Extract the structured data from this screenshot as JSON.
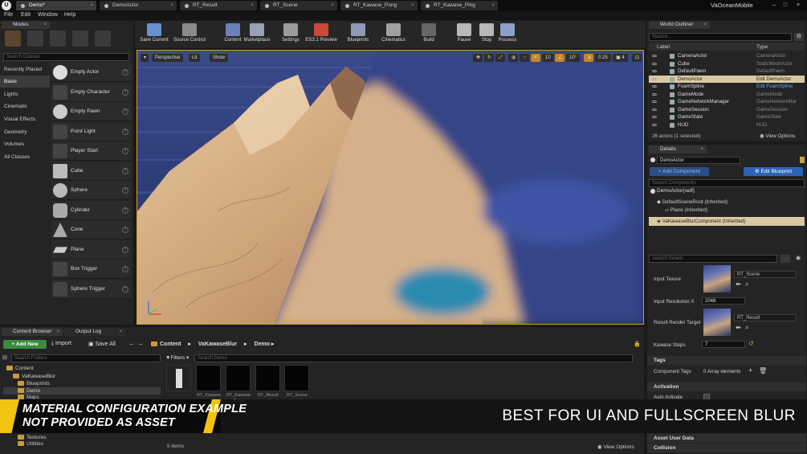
{
  "window": {
    "tabs": [
      {
        "label": "Demo*"
      },
      {
        "label": "DemoActor"
      },
      {
        "label": "RT_Result"
      },
      {
        "label": "RT_Scene"
      },
      {
        "label": "RT_Kawase_Pong"
      },
      {
        "label": "RT_Kawase_Ping"
      }
    ],
    "project_name": "VaOceanMobile"
  },
  "menu": {
    "items": [
      "File",
      "Edit",
      "Window",
      "Help"
    ]
  },
  "modes": {
    "tab_label": "Modes",
    "search_placeholder": "Search Classes",
    "categories": [
      "Recently Placed",
      "Basic",
      "Lights",
      "Cinematic",
      "Visual Effects",
      "Geometry",
      "Volumes",
      "All Classes"
    ],
    "selected_category": "Basic",
    "items": [
      "Empty Actor",
      "Empty Character",
      "Empty Pawn",
      "Point Light",
      "Player Start",
      "Cube",
      "Sphere",
      "Cylinder",
      "Cone",
      "Plane",
      "Box Trigger",
      "Sphere Trigger"
    ]
  },
  "toolbar": {
    "items": [
      {
        "label": "Save Current",
        "icon": "save-icon",
        "color": "#6a8fd0"
      },
      {
        "label": "Source Control",
        "icon": "source-control-icon",
        "color": "#8a8a8a"
      },
      {
        "label": "Content",
        "icon": "content-icon",
        "color": "#6d7fb8"
      },
      {
        "label": "Marketplace",
        "icon": "marketplace-icon",
        "color": "#9aa0b4"
      },
      {
        "label": "Settings",
        "icon": "settings-icon",
        "color": "#9c9c9c"
      },
      {
        "label": "ES3.1 Preview",
        "icon": "preview-icon",
        "color": "#c84a3a"
      },
      {
        "label": "Blueprints",
        "icon": "blueprints-icon",
        "color": "#8e9ab6"
      },
      {
        "label": "Cinematics",
        "icon": "cinematics-icon",
        "color": "#a0a0a0"
      },
      {
        "label": "Build",
        "icon": "build-icon",
        "color": "#666"
      },
      {
        "label": "Pause",
        "icon": "pause-icon",
        "color": "#b8b8b8"
      },
      {
        "label": "Stop",
        "icon": "stop-icon",
        "color": "#b8b8b8"
      },
      {
        "label": "Possess",
        "icon": "possess-icon",
        "color": "#8ea0c8"
      }
    ]
  },
  "viewport": {
    "perspective_label": "Perspective",
    "lit_label": "Lit",
    "show_label": "Show",
    "grid_value": "10",
    "angle_value": "10°",
    "scale_value": "0.25",
    "camera_speed": "4"
  },
  "outliner": {
    "tab_label": "World Outliner",
    "search_placeholder": "Search...",
    "col_label": "Label",
    "col_type": "Type",
    "rows": [
      {
        "label": "CameraActor",
        "type": "CameraActor"
      },
      {
        "label": "Cube",
        "type": "StaticMeshActor"
      },
      {
        "label": "DefaultPawn",
        "type": "DefaultPawn"
      },
      {
        "label": "DemoActor",
        "type": "Edit DemoActor",
        "selected": true
      },
      {
        "label": "FoamSpline",
        "type": "Edit FoamSpline"
      },
      {
        "label": "GameMode",
        "type": "GameMode"
      },
      {
        "label": "GameNetworkManager",
        "type": "GameNetworkMar"
      },
      {
        "label": "GameSession",
        "type": "GameSession"
      },
      {
        "label": "GameState",
        "type": "GameState"
      },
      {
        "label": "HUD",
        "type": "HUD"
      }
    ],
    "status": "26 actors (1 selected)",
    "view_options": "View Options"
  },
  "details": {
    "tab_label": "Details",
    "name_value": "DemoActor",
    "add_component": "+ Add Component",
    "edit_blueprint": "Edit Blueprint",
    "search_components_placeholder": "Search Components",
    "self_label": "DemoActor(self)",
    "components": [
      "DefaultSceneRoot (Inherited)",
      "Plane (Inherited)",
      "VaKawaseBlurComponent (Inherited)"
    ],
    "search_details_placeholder": "Search Details",
    "input_texture_label": "Input Texure",
    "input_texture_value": "RT_Scene",
    "input_res_label": "Input Resolution X",
    "input_res_value": "2048",
    "result_rt_label": "Result Render Target",
    "result_rt_value": "RT_Result",
    "kawase_steps_label": "Kawase Steps",
    "kawase_steps_value": "7",
    "tags_section": "Tags",
    "component_tags_label": "Component Tags",
    "component_tags_value": "0 Array elements",
    "activation_section": "Activation",
    "auto_activate_label": "Auto Activate",
    "asset_user_data_section": "Asset User Data",
    "collision_section": "Collision"
  },
  "content_browser": {
    "tab_label": "Content Browser",
    "output_tab_label": "Output Log",
    "add_new": "Add New",
    "import": "Import",
    "save_all": "Save All",
    "path": [
      "Content",
      "VaKawaseBlur",
      "Demo"
    ],
    "search_folders_placeholder": "Search Folders",
    "filters_label": "Filters",
    "search_assets_placeholder": "Search Demo",
    "tree": [
      "Content",
      "VaKawaseBlur",
      "Blueprints",
      "Demo",
      "Maps",
      "Textures",
      "Utilities"
    ],
    "assets": [
      {
        "label": ""
      },
      {
        "label": "RT_Kawase"
      },
      {
        "label": "RT_Kawase Pong"
      },
      {
        "label": "RT_Result"
      },
      {
        "label": "RT_Scene"
      }
    ],
    "item_count": "5 items",
    "view_options": "View Options"
  },
  "overlay": {
    "left_line1": "MATERIAL CONFIGURATION EXAMPLE",
    "left_line2": "NOT PROVIDED AS ASSET",
    "right_text": "BEST FOR UI AND FULLSCREEN BLUR",
    "accent_color": "#f2c40f"
  }
}
